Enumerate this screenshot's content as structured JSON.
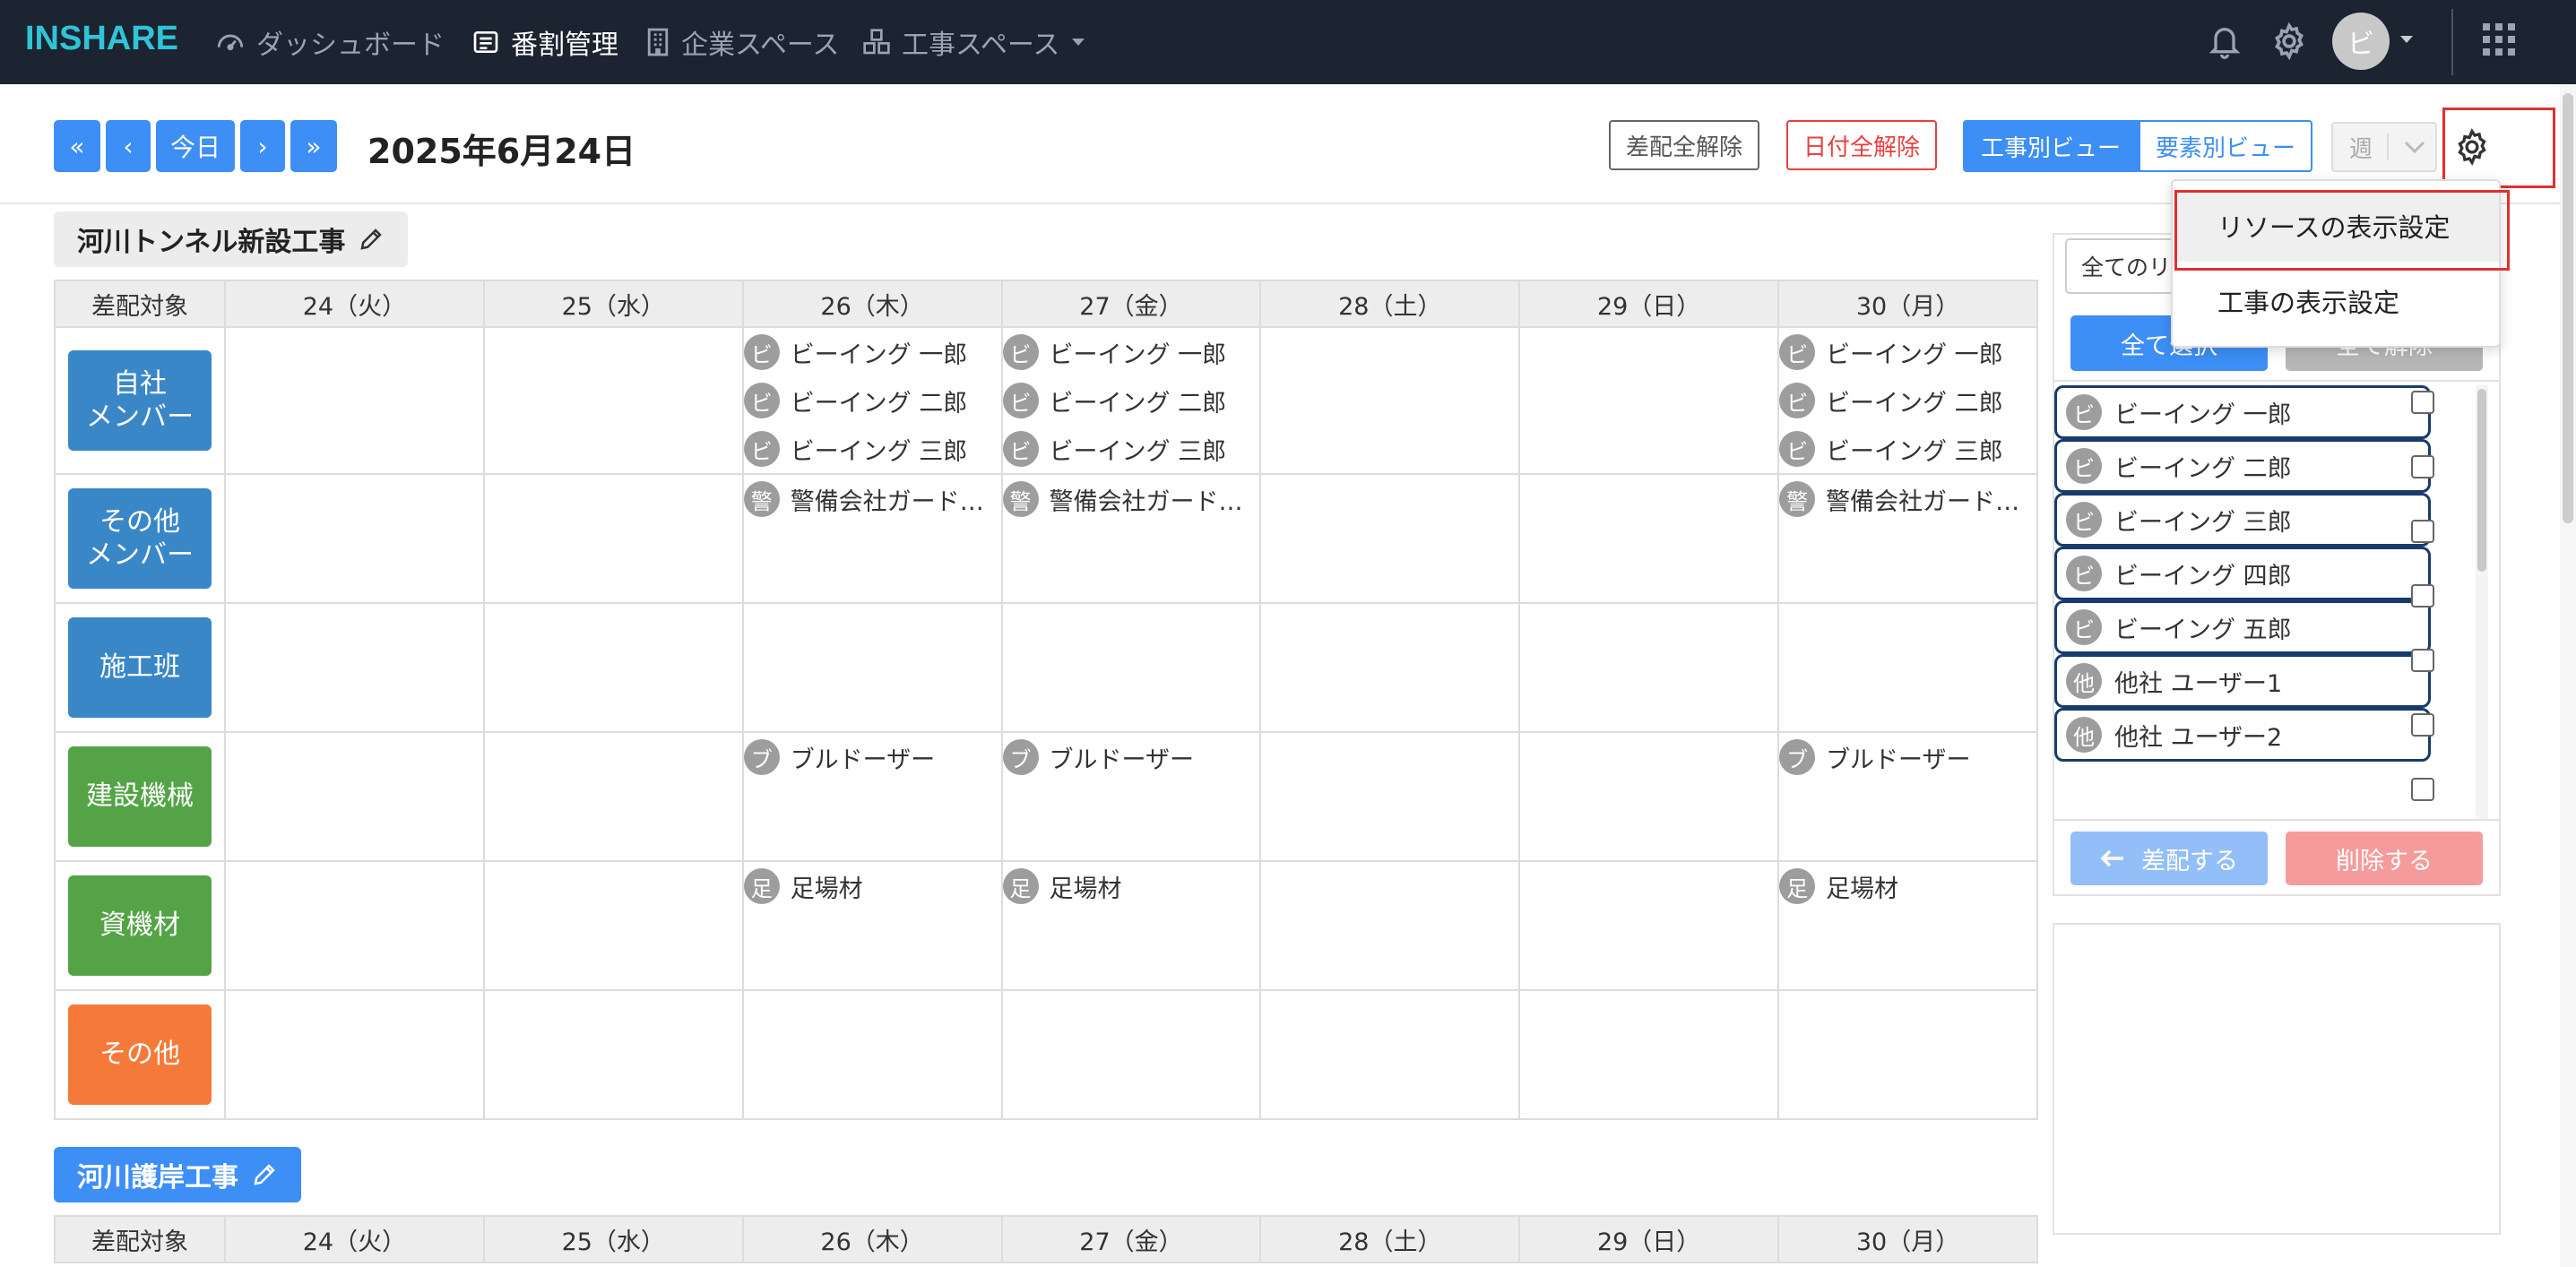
{
  "navbar": {
    "logo": "INSHARE",
    "links": [
      {
        "label": "ダッシュボード"
      },
      {
        "label": "番割管理"
      },
      {
        "label": "企業スペース"
      },
      {
        "label": "工事スペース"
      }
    ],
    "avatar": "ビ"
  },
  "toolbar": {
    "first": "«",
    "prev": "‹",
    "today": "今日",
    "next": "›",
    "last": "»",
    "date": "2025年6月24日",
    "clear_assign": "差配全解除",
    "clear_date": "日付全解除",
    "view_by_project": "工事別ビュー",
    "view_by_element": "要素別ビュー",
    "period": "週"
  },
  "settings_menu": {
    "items": [
      "リソースの表示設定",
      "工事の表示設定"
    ]
  },
  "colors": {
    "navbar": "#1c2331",
    "primary": "#3d8ef5",
    "row_blue": "#3a87c8",
    "row_green": "#54a447",
    "row_orange": "#f57a3a",
    "saturday": "#b3d3fb",
    "sunday": "#fbc9c9",
    "highlight": "#e03030"
  },
  "grid_header": {
    "target": "差配対象",
    "days": [
      "24（火）",
      "25（水）",
      "26（木）",
      "27（金）",
      "28（土）",
      "29（日）",
      "30（月）"
    ]
  },
  "projects": [
    {
      "name": "河川トンネル新設工事",
      "rows": [
        {
          "label": "自社\nメンバー",
          "cells": [
            [],
            [],
            [
              [
                "ビ",
                "ビーイング 一郎"
              ],
              [
                "ビ",
                "ビーイング 二郎"
              ],
              [
                "ビ",
                "ビーイング 三郎"
              ]
            ],
            [
              [
                "ビ",
                "ビーイング 一郎"
              ],
              [
                "ビ",
                "ビーイング 二郎"
              ],
              [
                "ビ",
                "ビーイング 三郎"
              ]
            ],
            [],
            [],
            [
              [
                "ビ",
                "ビーイング 一郎"
              ],
              [
                "ビ",
                "ビーイング 二郎"
              ],
              [
                "ビ",
                "ビーイング 三郎"
              ]
            ]
          ]
        },
        {
          "label": "その他\nメンバー",
          "cells": [
            [],
            [],
            [
              [
                "警",
                "警備会社ガードマン"
              ]
            ],
            [
              [
                "警",
                "警備会社ガードマン"
              ]
            ],
            [],
            [],
            [
              [
                "警",
                "警備会社ガードマン"
              ]
            ]
          ]
        },
        {
          "label": "施工班",
          "cells": [
            [],
            [],
            [],
            [],
            [],
            [],
            []
          ]
        },
        {
          "label": "建設機械",
          "cells": [
            [],
            [],
            [
              [
                "ブ",
                "ブルドーザー"
              ]
            ],
            [
              [
                "ブ",
                "ブルドーザー"
              ]
            ],
            [],
            [],
            [
              [
                "ブ",
                "ブルドーザー"
              ]
            ]
          ]
        },
        {
          "label": "資機材",
          "cells": [
            [],
            [],
            [
              [
                "足",
                "足場材"
              ]
            ],
            [
              [
                "足",
                "足場材"
              ]
            ],
            [],
            [],
            [
              [
                "足",
                "足場材"
              ]
            ]
          ]
        },
        {
          "label": "その他",
          "cells": [
            [],
            [],
            [],
            [],
            [],
            [],
            []
          ]
        }
      ]
    },
    {
      "name": "河川護岸工事"
    }
  ],
  "resource_panel": {
    "filter": "全てのリ",
    "select_all": "全て選択",
    "clear_all": "全て解除",
    "resources": [
      {
        "avatar": "ビ",
        "name": "ビーイング 一郎"
      },
      {
        "avatar": "ビ",
        "name": "ビーイング 二郎"
      },
      {
        "avatar": "ビ",
        "name": "ビーイング 三郎"
      },
      {
        "avatar": "ビ",
        "name": "ビーイング 四郎"
      },
      {
        "avatar": "ビ",
        "name": "ビーイング 五郎"
      },
      {
        "avatar": "他",
        "name": "他社 ユーザー1"
      },
      {
        "avatar": "他",
        "name": "他社 ユーザー2"
      }
    ],
    "assign": "差配する",
    "delete": "削除する"
  }
}
